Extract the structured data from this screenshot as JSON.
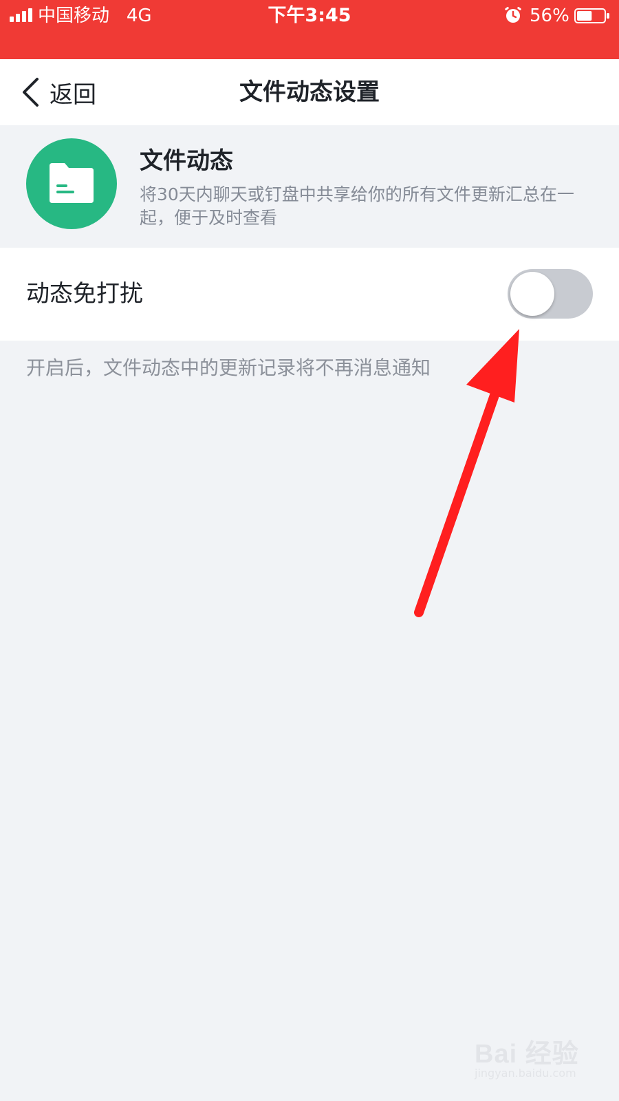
{
  "status_bar": {
    "carrier": "中国移动",
    "network": "4G",
    "time": "下午3:45",
    "battery_percent": "56%",
    "battery_level": 0.56,
    "icons": [
      "signal-icon",
      "alarm-icon",
      "battery-icon"
    ]
  },
  "nav": {
    "back_label": "返回",
    "title": "文件动态设置"
  },
  "feature": {
    "icon": "folder-icon",
    "title": "文件动态",
    "description": "将30天内聊天或钉盘中共享给你的所有文件更新汇总在一起，便于及时查看"
  },
  "setting": {
    "label": "动态免打扰",
    "enabled": false,
    "hint": "开启后，文件动态中的更新记录将不再消息通知"
  },
  "watermark": {
    "brand": "Bai 经验",
    "url": "jingyan.baidu.com"
  },
  "colors": {
    "status_bar": "#f03a35",
    "accent_green": "#27b883",
    "page_background": "#f1f3f6",
    "toggle_off": "#c8cbd1",
    "annotation_arrow": "#ff1f1f"
  }
}
